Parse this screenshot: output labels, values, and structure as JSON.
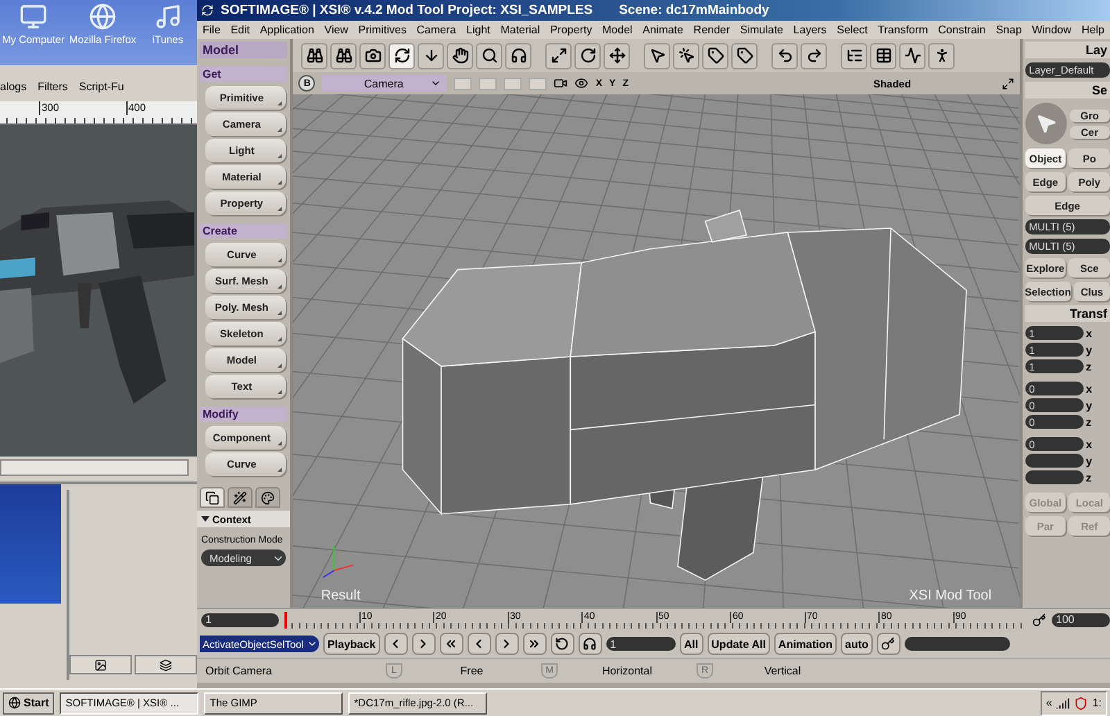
{
  "desktop": {
    "icons": [
      {
        "kind": "computer",
        "label": "My Computer"
      },
      {
        "kind": "browser",
        "label": "Mozilla Firefox"
      },
      {
        "kind": "music",
        "label": "iTunes"
      }
    ]
  },
  "gimp": {
    "menu": [
      "alogs",
      "Filters",
      "Script-Fu"
    ],
    "ruler": [
      "300",
      "400"
    ],
    "image": {
      "kind": "picture"
    }
  },
  "xsi": {
    "title": "SOFTIMAGE® | XSI® v.4.2 Mod Tool Project: XSI_SAMPLES",
    "scene": "Scene: dc17mMainbody",
    "menu": [
      "File",
      "Edit",
      "Application",
      "View",
      "Primitives",
      "Camera",
      "Light",
      "Material",
      "Property",
      "Model",
      "Animate",
      "Render",
      "Simulate",
      "Layers",
      "Select",
      "Transform",
      "Constrain",
      "Snap",
      "Window",
      "Help"
    ],
    "toolbar": [
      [
        {
          "kind": "binoculars",
          "selected": false
        },
        {
          "kind": "binoculars",
          "selected": false
        },
        {
          "kind": "camera",
          "selected": false
        },
        {
          "kind": "orbit",
          "selected": true
        },
        {
          "kind": "dolly",
          "selected": false
        },
        {
          "kind": "pan",
          "selected": false
        },
        {
          "kind": "zoom",
          "selected": false
        },
        {
          "kind": "roll",
          "selected": false
        }
      ],
      [
        {
          "kind": "frame",
          "selected": false
        },
        {
          "kind": "rotate",
          "selected": false
        },
        {
          "kind": "move",
          "selected": false
        }
      ],
      [
        {
          "kind": "select",
          "selected": false
        },
        {
          "kind": "select-point",
          "selected": false
        },
        {
          "kind": "tag",
          "selected": false
        },
        {
          "kind": "tag",
          "selected": false
        }
      ],
      [
        {
          "kind": "undo",
          "selected": false
        },
        {
          "kind": "redo",
          "selected": false
        }
      ],
      [
        {
          "kind": "tree",
          "selected": false
        },
        {
          "kind": "table",
          "selected": false
        },
        {
          "kind": "graph",
          "selected": false
        },
        {
          "kind": "figure",
          "selected": false
        }
      ]
    ],
    "left_panel": {
      "title": "Model",
      "sections": [
        {
          "title": "Get",
          "buttons": [
            "Primitive",
            "Camera",
            "Light",
            "Material",
            "Property"
          ]
        },
        {
          "title": "Create",
          "buttons": [
            "Curve",
            "Surf. Mesh",
            "Poly. Mesh",
            "Skeleton",
            "Model",
            "Text"
          ]
        },
        {
          "title": "Modify",
          "buttons": [
            "Component",
            "Curve"
          ]
        }
      ],
      "tabs": [
        {
          "kind": "pages",
          "selected": true
        },
        {
          "kind": "brush",
          "selected": false
        },
        {
          "kind": "palette",
          "selected": false
        }
      ],
      "context": {
        "label": "Context",
        "expanded": true
      },
      "construction_mode": {
        "label": "Construction Mode",
        "value": "Modeling"
      }
    },
    "viewport": {
      "button": "B",
      "camera": "Camera",
      "axes": [
        "X",
        "Y",
        "Z"
      ],
      "mode": "Shaded",
      "result": "Result",
      "brand": "XSI Mod Tool"
    },
    "right_panel": {
      "layers": {
        "title": "Lay",
        "layer": "Layer_Default"
      },
      "select": {
        "title": "Se",
        "side": [
          "Gro",
          "Cer"
        ],
        "filters": [
          {
            "label": "Object",
            "selected": true
          },
          {
            "label": "Po",
            "selected": false
          },
          {
            "label": "Edge",
            "selected": false
          },
          {
            "label": "Poly",
            "selected": false
          }
        ],
        "edge": "Edge",
        "multi": [
          "MULTI (5)",
          "MULTI (5)"
        ],
        "tabs": [
          "Explore",
          "Sce",
          "Selection",
          "Clus"
        ]
      },
      "transform": {
        "title": "Transf",
        "groups": [
          [
            {
              "value": "1",
              "axis": "x"
            },
            {
              "value": "1",
              "axis": "y"
            },
            {
              "value": "1",
              "axis": "z"
            }
          ],
          [
            {
              "value": "0",
              "axis": "x"
            },
            {
              "value": "0",
              "axis": "y"
            },
            {
              "value": "0",
              "axis": "z"
            }
          ],
          [
            {
              "value": "0",
              "axis": "x"
            },
            {
              "axis": "y"
            },
            {
              "axis": "z"
            }
          ]
        ],
        "refs": [
          {
            "label": "Global",
            "disabled": true
          },
          {
            "label": "Local",
            "disabled": true
          },
          {
            "label": "Par",
            "disabled": true
          },
          {
            "label": "Ref",
            "disabled": true
          }
        ]
      }
    },
    "timeline": {
      "start": "1",
      "ticks": [
        "10",
        "20",
        "30",
        "40",
        "50",
        "60",
        "70",
        "80",
        "90"
      ],
      "end": "100"
    },
    "playback": {
      "tool": "ActivateObjectSelTool",
      "playback": "Playback",
      "transport": [
        {
          "kind": "prev-key"
        },
        {
          "kind": "next-key"
        },
        {
          "kind": "first"
        },
        {
          "kind": "back"
        },
        {
          "kind": "forward"
        },
        {
          "kind": "last"
        },
        {
          "kind": "loop"
        },
        {
          "kind": "audio"
        }
      ],
      "frame": "1",
      "all": "All",
      "update_all": "Update All",
      "animation": "Animation",
      "auto": "auto"
    },
    "status": {
      "message": "Orbit Camera",
      "mouse": [
        {
          "button": "L",
          "action": "Free"
        },
        {
          "button": "M",
          "action": "Horizontal"
        },
        {
          "button": "R",
          "action": "Vertical"
        }
      ]
    }
  },
  "taskbar": {
    "start": "Start",
    "tasks": [
      {
        "label": "SOFTIMAGE® | XSI® ...",
        "selected": true
      },
      {
        "label": "The GIMP",
        "selected": false
      },
      {
        "label": "*DC17m_rifle.jpg-2.0 (R...",
        "selected": false
      }
    ],
    "tray": {
      "expand": "«",
      "clock": "1:"
    }
  }
}
